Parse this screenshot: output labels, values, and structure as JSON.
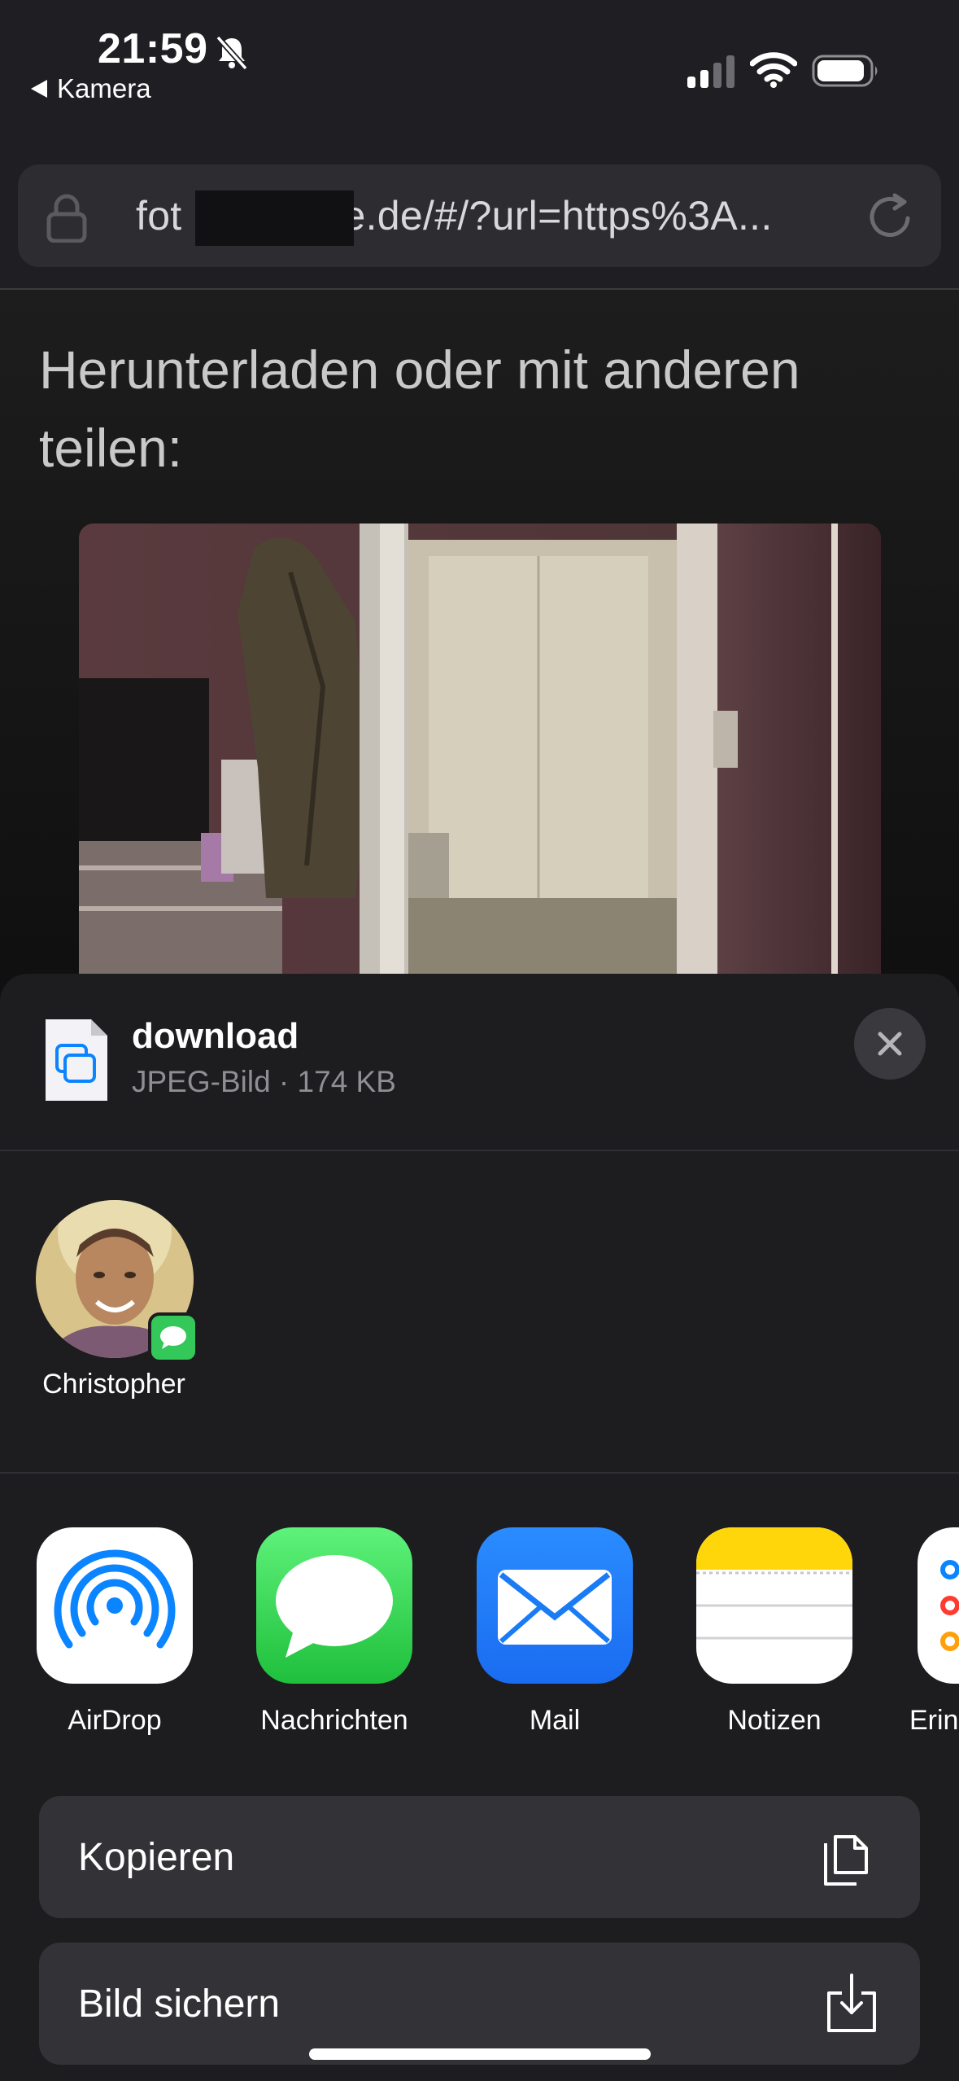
{
  "status_bar": {
    "time": "21:59",
    "back_app": "Kamera"
  },
  "url_bar": {
    "url_prefix": "fot",
    "url_suffix": "e.de/#/?url=https%3A..."
  },
  "page": {
    "heading": "Herunterladen oder mit anderen teilen:"
  },
  "share_sheet": {
    "file_name": "download",
    "file_meta": "JPEG-Bild · 174 KB",
    "contacts": [
      {
        "name": "Christopher",
        "badge": "messages-badge-icon"
      }
    ],
    "apps": [
      {
        "label": "AirDrop",
        "icon": "airdrop-icon"
      },
      {
        "label": "Nachrichten",
        "icon": "messages-icon"
      },
      {
        "label": "Mail",
        "icon": "mail-icon"
      },
      {
        "label": "Notizen",
        "icon": "notes-icon"
      },
      {
        "label": "Erin",
        "icon": "reminders-icon"
      }
    ],
    "actions": [
      {
        "label": "Kopieren",
        "icon": "copy-icon"
      },
      {
        "label": "Bild sichern",
        "icon": "save-image-icon"
      }
    ]
  },
  "colors": {
    "accent_blue": "#0a84ff",
    "messages_green": "#34c759",
    "notes_yellow": "#ffd60a"
  }
}
